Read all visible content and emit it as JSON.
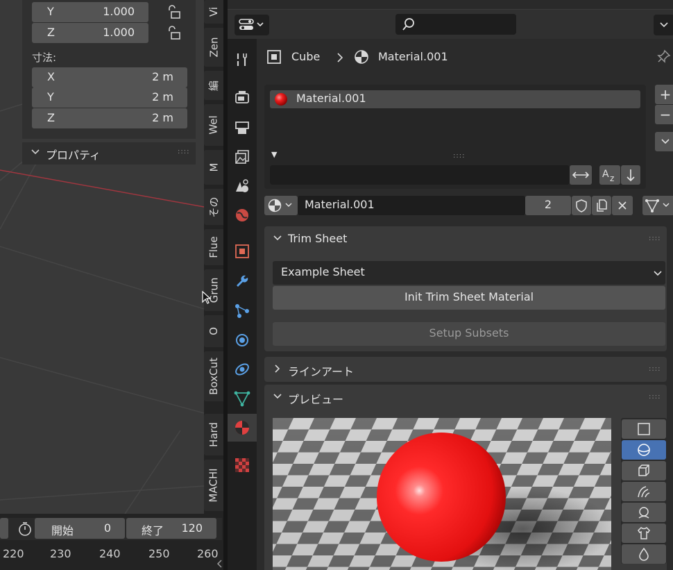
{
  "npanel": {
    "scale_rows": [
      {
        "axis": "Y",
        "value": "1.000"
      },
      {
        "axis": "Z",
        "value": "1.000"
      }
    ],
    "dimensions_label": "寸法:",
    "dimensions": [
      {
        "axis": "X",
        "value": "2 m"
      },
      {
        "axis": "Y",
        "value": "2 m"
      },
      {
        "axis": "Z",
        "value": "2 m"
      }
    ],
    "properties_label": "プロパティ"
  },
  "side_tabs": [
    "Vi",
    "Zen",
    "編",
    "Wel",
    "M",
    "その",
    "Flue",
    "Grun",
    "O",
    "BoxCut",
    "Hard",
    "MACHI"
  ],
  "timeline": {
    "start_label": "開始",
    "start_value": "0",
    "end_label": "終了",
    "end_value": "120",
    "frame_numbers": [
      "220",
      "230",
      "240",
      "250",
      "260"
    ]
  },
  "properties": {
    "breadcrumb": {
      "object": "Cube",
      "material": "Material.001"
    },
    "slots": [
      {
        "name": "Material.001"
      }
    ],
    "datablock": {
      "name": "Material.001",
      "users": "2"
    },
    "panels": {
      "trim_sheet": {
        "title": "Trim Sheet",
        "dropdown": "Example Sheet",
        "init_button": "Init Trim Sheet Material",
        "subsets_button": "Setup Subsets"
      },
      "lineart": {
        "title": "ラインアート"
      },
      "preview": {
        "title": "プレビュー"
      }
    },
    "tabs": [
      "tool",
      "render",
      "output",
      "view-layer",
      "scene",
      "world",
      "object",
      "modifiers",
      "particles",
      "physics",
      "constraints",
      "data",
      "material",
      "texture"
    ],
    "active_tab": "material"
  },
  "colors": {
    "accent_blue": "#4772b3",
    "material_red": "#e01010",
    "panel_bg": "#3a3a3a",
    "field_bg": "#545454"
  }
}
